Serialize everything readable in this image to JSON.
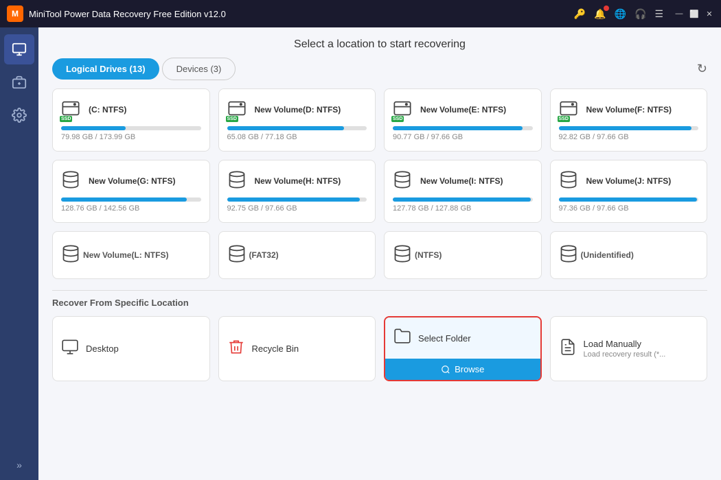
{
  "titleBar": {
    "title": "MiniTool Power Data Recovery Free Edition v12.0",
    "icons": [
      "🔑",
      "🔔",
      "🌐",
      "🎧",
      "☰"
    ],
    "controls": [
      "—",
      "⬜",
      "✕"
    ]
  },
  "sidebar": {
    "items": [
      {
        "id": "recovery",
        "icon": "💾",
        "active": true
      },
      {
        "id": "tools",
        "icon": "🧰",
        "active": false
      },
      {
        "id": "settings",
        "icon": "⚙",
        "active": false
      }
    ],
    "expand_label": "»"
  },
  "header": {
    "title": "Select a location to start recovering"
  },
  "tabs": {
    "tab1": {
      "label": "Logical Drives (13)",
      "active": true
    },
    "tab2": {
      "label": "Devices (3)",
      "active": false
    }
  },
  "drives": [
    {
      "name": "(C: NTFS)",
      "ssd": true,
      "used": 79.98,
      "total": 173.99,
      "fill_pct": 46
    },
    {
      "name": "New Volume(D: NTFS)",
      "ssd": true,
      "used": 65.08,
      "total": 77.18,
      "fill_pct": 84
    },
    {
      "name": "New Volume(E: NTFS)",
      "ssd": true,
      "used": 90.77,
      "total": 97.66,
      "fill_pct": 93
    },
    {
      "name": "New Volume(F: NTFS)",
      "ssd": true,
      "used": 92.82,
      "total": 97.66,
      "fill_pct": 95
    },
    {
      "name": "New Volume(G: NTFS)",
      "ssd": false,
      "used": 128.76,
      "total": 142.56,
      "fill_pct": 90
    },
    {
      "name": "New Volume(H: NTFS)",
      "ssd": false,
      "used": 92.75,
      "total": 97.66,
      "fill_pct": 95
    },
    {
      "name": "New Volume(I: NTFS)",
      "ssd": false,
      "used": 127.78,
      "total": 127.88,
      "fill_pct": 99
    },
    {
      "name": "New Volume(J: NTFS)",
      "ssd": false,
      "used": 97.36,
      "total": 97.66,
      "fill_pct": 99
    },
    {
      "name": "New Volume(L: NTFS)",
      "ssd": false,
      "empty": true
    },
    {
      "name": "(FAT32)",
      "ssd": false,
      "empty": true
    },
    {
      "name": "(NTFS)",
      "ssd": false,
      "empty": true
    },
    {
      "name": "(Unidentified)",
      "ssd": false,
      "empty": true
    }
  ],
  "specificLocation": {
    "title": "Recover From Specific Location",
    "items": [
      {
        "id": "desktop",
        "icon": "🖥",
        "label": "Desktop",
        "sublabel": ""
      },
      {
        "id": "recycle-bin",
        "icon": "🗑",
        "label": "Recycle Bin",
        "sublabel": ""
      },
      {
        "id": "select-folder",
        "icon": "📁",
        "label": "Select Folder",
        "browse_label": "Browse",
        "selected": true
      },
      {
        "id": "load-manually",
        "icon": "📋",
        "label": "Load Manually",
        "sublabel": "Load recovery result (*..."
      }
    ]
  }
}
